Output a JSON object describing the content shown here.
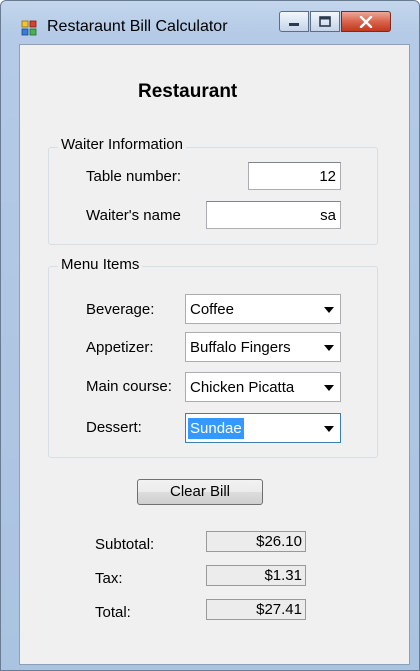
{
  "window": {
    "title": "Restaraunt Bill Calculator",
    "minimize_glyph": "–",
    "maximize_glyph": "▢",
    "close_glyph": "✕"
  },
  "heading": "Restaurant",
  "waiter_group": {
    "legend": "Waiter Information",
    "table_label": "Table number:",
    "table_value": "12",
    "name_label": "Waiter's name",
    "name_value": "sa"
  },
  "menu_group": {
    "legend": "Menu Items",
    "beverage_label": "Beverage:",
    "beverage_value": "Coffee",
    "appetizer_label": "Appetizer:",
    "appetizer_value": "Buffalo Fingers",
    "main_label": "Main course:",
    "main_value": "Chicken Picatta",
    "dessert_label": "Dessert:",
    "dessert_value": "Sundae"
  },
  "clear_button": "Clear Bill",
  "totals": {
    "subtotal_label": "Subtotal:",
    "subtotal_value": "$26.10",
    "tax_label": "Tax:",
    "tax_value": "$1.31",
    "total_label": "Total:",
    "total_value": "$27.41"
  },
  "icons": {
    "app": "app-icon",
    "minimize": "minimize-icon",
    "maximize": "maximize-icon",
    "close": "close-icon",
    "dropdown": "chevron-down-icon"
  },
  "colors": {
    "selection": "#3399ff",
    "close_button": "#c2391d",
    "client_background": "#f0f0f0"
  }
}
